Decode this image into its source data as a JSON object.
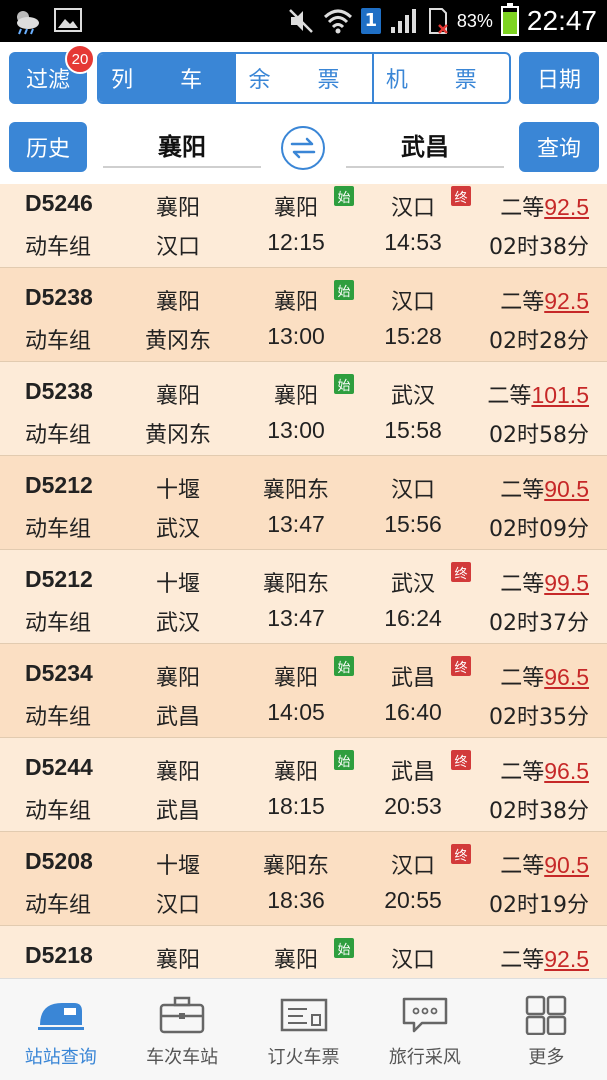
{
  "status_bar": {
    "time": "22:47",
    "battery_pct": "83%",
    "battery_level": 0.83,
    "sim": "1"
  },
  "top": {
    "filter_label": "过滤",
    "filter_badge": "20",
    "tabs": [
      "列 车",
      "余 票",
      "机 票"
    ],
    "date_label": "日期",
    "history_label": "历史",
    "from_station": "襄阳",
    "to_station": "武昌",
    "query_label": "查询"
  },
  "trains": [
    {
      "no": "D5246",
      "type": "动车组",
      "orig": "襄阳",
      "dest": "汉口",
      "dep_station": "襄阳",
      "arr_station": "汉口",
      "start": true,
      "end": true,
      "dep_time": "12:15",
      "arr_time": "14:53",
      "seat": "二等",
      "price": "92.5",
      "duration": "02时38分"
    },
    {
      "no": "D5238",
      "type": "动车组",
      "orig": "襄阳",
      "dest": "黄冈东",
      "dep_station": "襄阳",
      "arr_station": "汉口",
      "start": true,
      "end": false,
      "dep_time": "13:00",
      "arr_time": "15:28",
      "seat": "二等",
      "price": "92.5",
      "duration": "02时28分"
    },
    {
      "no": "D5238",
      "type": "动车组",
      "orig": "襄阳",
      "dest": "黄冈东",
      "dep_station": "襄阳",
      "arr_station": "武汉",
      "start": true,
      "end": false,
      "dep_time": "13:00",
      "arr_time": "15:58",
      "seat": "二等",
      "price": "101.5",
      "duration": "02时58分"
    },
    {
      "no": "D5212",
      "type": "动车组",
      "orig": "十堰",
      "dest": "武汉",
      "dep_station": "襄阳东",
      "arr_station": "汉口",
      "start": false,
      "end": false,
      "dep_time": "13:47",
      "arr_time": "15:56",
      "seat": "二等",
      "price": "90.5",
      "duration": "02时09分"
    },
    {
      "no": "D5212",
      "type": "动车组",
      "orig": "十堰",
      "dest": "武汉",
      "dep_station": "襄阳东",
      "arr_station": "武汉",
      "start": false,
      "end": true,
      "dep_time": "13:47",
      "arr_time": "16:24",
      "seat": "二等",
      "price": "99.5",
      "duration": "02时37分"
    },
    {
      "no": "D5234",
      "type": "动车组",
      "orig": "襄阳",
      "dest": "武昌",
      "dep_station": "襄阳",
      "arr_station": "武昌",
      "start": true,
      "end": true,
      "dep_time": "14:05",
      "arr_time": "16:40",
      "seat": "二等",
      "price": "96.5",
      "duration": "02时35分"
    },
    {
      "no": "D5244",
      "type": "动车组",
      "orig": "襄阳",
      "dest": "武昌",
      "dep_station": "襄阳",
      "arr_station": "武昌",
      "start": true,
      "end": true,
      "dep_time": "18:15",
      "arr_time": "20:53",
      "seat": "二等",
      "price": "96.5",
      "duration": "02时38分"
    },
    {
      "no": "D5208",
      "type": "动车组",
      "orig": "十堰",
      "dest": "汉口",
      "dep_station": "襄阳东",
      "arr_station": "汉口",
      "start": false,
      "end": true,
      "dep_time": "18:36",
      "arr_time": "20:55",
      "seat": "二等",
      "price": "90.5",
      "duration": "02时19分"
    },
    {
      "no": "D5218",
      "type": "",
      "orig": "襄阳",
      "dest": "",
      "dep_station": "襄阳",
      "arr_station": "汉口",
      "start": true,
      "end": false,
      "dep_time": "",
      "arr_time": "",
      "seat": "二等",
      "price": "92.5",
      "duration": ""
    }
  ],
  "tag_text": {
    "start": "始",
    "end": "终"
  },
  "bottom_nav": [
    {
      "label": "站站查询",
      "icon": "train-icon",
      "active": true
    },
    {
      "label": "车次车站",
      "icon": "briefcase-icon",
      "active": false
    },
    {
      "label": "订火车票",
      "icon": "ticket-icon",
      "active": false
    },
    {
      "label": "旅行采风",
      "icon": "chat-bubble-icon",
      "active": false
    },
    {
      "label": "更多",
      "icon": "grid-icon",
      "active": false
    }
  ],
  "colors": {
    "accent": "#3a86d6",
    "row_light": "#fdebd8",
    "row_dark": "#fbdfc3",
    "price": "#c62828",
    "start_tag": "#2e9e3e",
    "end_tag": "#d23a3a"
  }
}
